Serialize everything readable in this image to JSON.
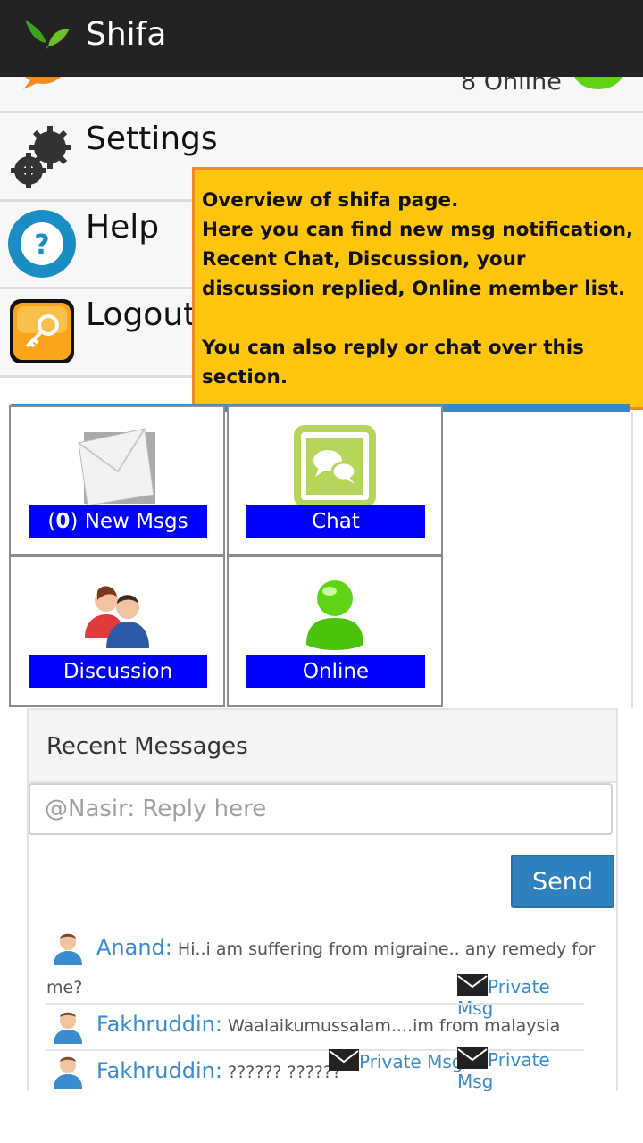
{
  "app": {
    "title": "Shifa"
  },
  "header_strip": {
    "online_count": "8 Online"
  },
  "menu": [
    {
      "label": "Settings",
      "icon": "gears-icon"
    },
    {
      "label": "Help",
      "icon": "help-icon"
    },
    {
      "label": "Logout",
      "icon": "key-icon"
    }
  ],
  "callout": {
    "lines": [
      "Overview of shifa page.",
      "Here you can find new msg notification, Recent Chat, Discussion, your discussion replied, Online member list.",
      "You can also reply or chat over this section."
    ]
  },
  "tiles": {
    "new_msgs": {
      "count": "0",
      "label_open": "(",
      "label_close": ") New Msgs"
    },
    "chat": {
      "label": "Chat"
    },
    "discussion": {
      "label": "Discussion"
    },
    "online": {
      "label": "Online"
    }
  },
  "recent": {
    "title": "Recent Messages",
    "reply_placeholder": "@Nasir: Reply here",
    "send_label": "Send",
    "messages": [
      {
        "name": "Anand:",
        "text": " Hi..i am suffering from migraine.. any remedy for",
        "text_cont": "me?",
        "pm": "Private Msg"
      },
      {
        "name": "Fakhruddin:",
        "text": " Waalaikumussalam....im from malaysia"
      },
      {
        "name": "Fakhruddin:",
        "text": " ?????? ??????",
        "pm1": "Private Msg",
        "pm2": "Private Msg"
      }
    ]
  },
  "colors": {
    "appbar": "#222222",
    "callout": "#ffc50d",
    "tile_label": "#0000ff",
    "link": "#3a8bd0",
    "send": "#2f81bd"
  }
}
